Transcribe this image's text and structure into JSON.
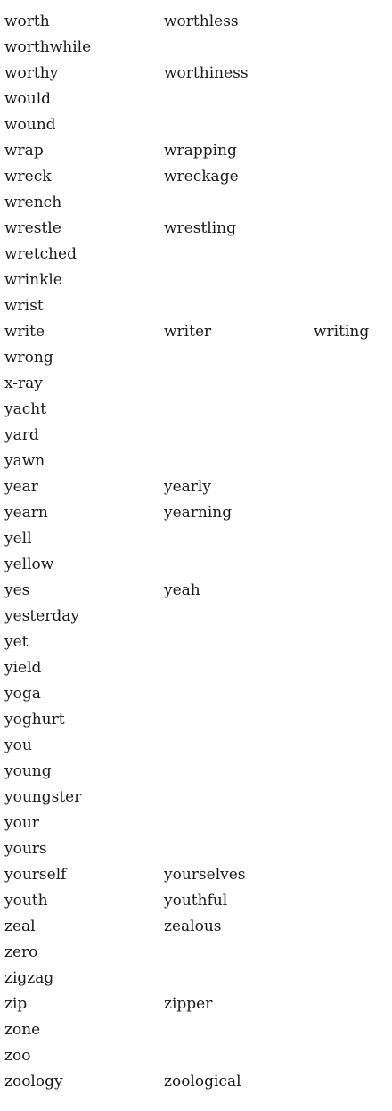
{
  "rows": [
    [
      "worth",
      "worthless"
    ],
    [
      "worthwhile"
    ],
    [
      "worthy",
      "worthiness"
    ],
    [
      "would"
    ],
    [
      "wound"
    ],
    [
      "wrap",
      "wrapping"
    ],
    [
      "wreck",
      "wreckage"
    ],
    [
      "wrench"
    ],
    [
      "wrestle",
      "wrestling"
    ],
    [
      "wretched"
    ],
    [
      "wrinkle"
    ],
    [
      "wrist"
    ],
    [
      "write",
      "writer",
      "writing"
    ],
    [
      "wrong"
    ],
    [
      "x-ray"
    ],
    [
      "yacht"
    ],
    [
      "yard"
    ],
    [
      "yawn"
    ],
    [
      "year",
      "yearly"
    ],
    [
      "yearn",
      "yearning"
    ],
    [
      "yell"
    ],
    [
      "yellow"
    ],
    [
      "yes",
      "yeah"
    ],
    [
      "yesterday"
    ],
    [
      "yet"
    ],
    [
      "yield"
    ],
    [
      "yoga"
    ],
    [
      "yoghurt"
    ],
    [
      "you"
    ],
    [
      "young"
    ],
    [
      "youngster"
    ],
    [
      "your"
    ],
    [
      "yours"
    ],
    [
      "yourself",
      "yourselves"
    ],
    [
      "youth",
      "youthful"
    ],
    [
      "zeal",
      "zealous"
    ],
    [
      "zero"
    ],
    [
      "zigzag"
    ],
    [
      "zip",
      "zipper"
    ],
    [
      "zone"
    ],
    [
      "zoo"
    ],
    [
      "zoology",
      "zoological"
    ]
  ]
}
